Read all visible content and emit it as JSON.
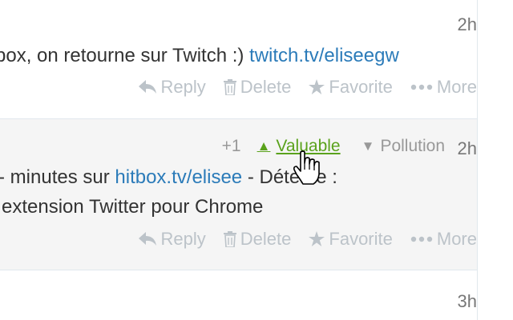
{
  "tweets": [
    {
      "time": "2h",
      "text_before": "box, on retourne sur Twitch :) ",
      "link": "twitch.tv/eliseegw",
      "actions": {
        "reply": "Reply",
        "delete": "Delete",
        "favorite": "Favorite",
        "more": "More"
      }
    },
    {
      "time": "2h",
      "vote": {
        "count": "+1",
        "valuable": "Valuable",
        "pollution": "Pollution"
      },
      "line1_before": "minutes sur ",
      "link": "hitbox.tv/elisee",
      "line1_after": " - Détente :",
      "line2": "extension Twitter pour Chrome",
      "actions": {
        "reply": "Reply",
        "delete": "Delete",
        "favorite": "Favorite",
        "more": "More"
      }
    },
    {
      "time": "3h"
    }
  ],
  "colors": {
    "link": "#2b7bb9",
    "action": "#bcc3c9",
    "valuable": "#5aa21c",
    "muted": "#999999",
    "highlight_bg": "#f5f5f5"
  },
  "icons": [
    "reply-icon",
    "trash-icon",
    "star-icon",
    "dots-icon",
    "triangle-up-icon",
    "triangle-down-icon",
    "hand-cursor-icon"
  ]
}
